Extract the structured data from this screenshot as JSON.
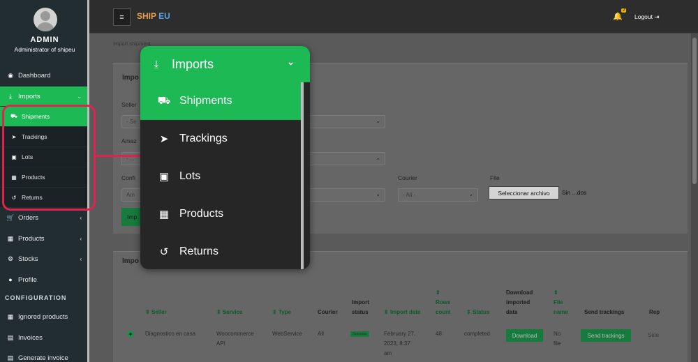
{
  "user": {
    "name": "ADMIN",
    "role": "Administrator of shipeu"
  },
  "brand": {
    "part1": "SHIP",
    "part2": "EU",
    "color1": "#e9a04a",
    "color2": "#5ca2e6"
  },
  "topbar": {
    "menu_icon": "hamburger-icon",
    "notifications_count": "2",
    "logout_label": "Logout"
  },
  "sidebar": {
    "dashboard": "Dashboard",
    "imports": "Imports",
    "imports_sub": {
      "shipments": "Shipments",
      "trackings": "Trackings",
      "lots": "Lots",
      "products": "Products",
      "returns": "Returns"
    },
    "orders": "Orders",
    "products": "Products",
    "stocks": "Stocks",
    "profile": "Profile",
    "section_configuration": "CONFIGURATION",
    "ignored_products": "Ignored products",
    "invoices": "Invoices",
    "generate_invoice": "Generate invoice"
  },
  "content": {
    "breadcrumb": "Import shipment",
    "panel1_title": "Impo",
    "seller_label": "Seller",
    "seller_value": "- Se",
    "amazon_label": "Amaz",
    "amazon_value": "- ...",
    "config_label": "Confi",
    "config_value": "Am",
    "courier_label": "Courier",
    "courier_value": "- All -",
    "file_label": "File",
    "file_button": "Seleccionar archivo",
    "file_status": "Sin ...dos",
    "import_button": "Imp",
    "panel2_title": "Impo"
  },
  "table": {
    "headers": {
      "seller": "Seller",
      "service": "Service",
      "type": "Type",
      "courier": "Courier",
      "import_status_1": "Import",
      "import_status_2": "status",
      "import_date": "Import date",
      "rows_count_1": "Rows",
      "rows_count_2": "count",
      "status": "Status",
      "download_1": "Download",
      "download_2": "imported",
      "download_3": "data",
      "file_name_1": "File",
      "file_name_2": "name",
      "send_trackings": "Send trackings",
      "rep": "Rep"
    },
    "row": {
      "seller": "Diagnostico en casa",
      "service_1": "Woocommerce",
      "service_2": "API",
      "type": "WebService",
      "courier": "All",
      "import_status": "Success",
      "date_1": "February 27,",
      "date_2": "2023, 8:37",
      "date_3": "am",
      "rows_count": "48",
      "status": "completed",
      "download": "Download",
      "file_name_1": "No",
      "file_name_2": "file",
      "send_trackings": "Send trackings",
      "rep": "Sele"
    }
  },
  "zoom": {
    "header": "Imports",
    "items": {
      "shipments": "Shipments",
      "trackings": "Trackings",
      "lots": "Lots",
      "products": "Products",
      "returns": "Returns"
    }
  },
  "colors": {
    "accent": "#1db954",
    "highlight": "#e0234e",
    "sidebar_bg": "#222d32"
  }
}
